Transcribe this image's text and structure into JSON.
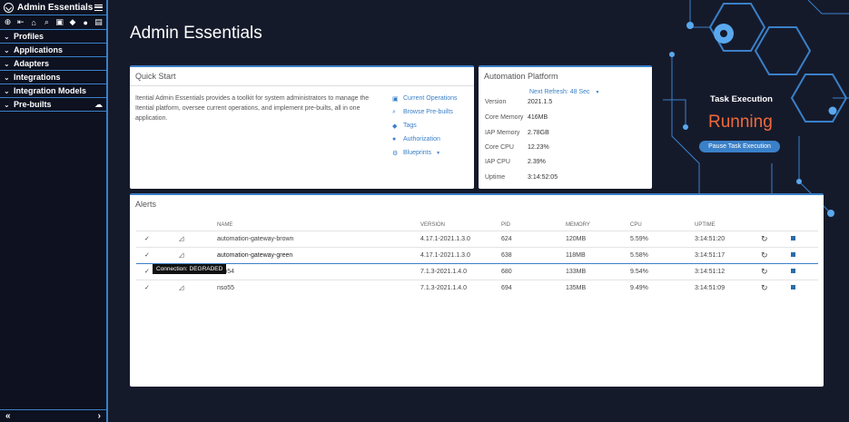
{
  "sidebar": {
    "title": "Admin Essentials",
    "tools": [
      "⊕",
      "⇤",
      "⌂",
      "⌕",
      "▣",
      "◆",
      "●",
      "▤"
    ],
    "items": [
      {
        "label": "Profiles"
      },
      {
        "label": "Applications"
      },
      {
        "label": "Adapters"
      },
      {
        "label": "Integrations"
      },
      {
        "label": "Integration Models"
      },
      {
        "label": "Pre-builts"
      }
    ],
    "footer_left": "«",
    "footer_right": "›"
  },
  "page": {
    "title": "Admin Essentials"
  },
  "quick_start": {
    "title": "Quick Start",
    "description": "Itential Admin Essentials provides a toolkit for system administrators to manage the Itential platform, oversee current operations, and implement pre-builts, all in one application.",
    "links": [
      {
        "label": "Current Operations",
        "icon": "briefcase-icon"
      },
      {
        "label": "Browse Pre-builts",
        "icon": "search-icon"
      },
      {
        "label": "Tags",
        "icon": "tag-icon"
      },
      {
        "label": "Authorization",
        "icon": "user-circle-icon"
      },
      {
        "label": "Blueprints",
        "icon": "gear-icon"
      }
    ]
  },
  "automation_platform": {
    "title": "Automation Platform",
    "next_refresh": "Next Refresh: 48 Sec",
    "rows": [
      {
        "key": "Version",
        "value": "2021.1.5"
      },
      {
        "key": "Core Memory",
        "value": "416MB"
      },
      {
        "key": "IAP Memory",
        "value": "2.78GB"
      },
      {
        "key": "Core CPU",
        "value": "12.23%"
      },
      {
        "key": "IAP CPU",
        "value": "2.39%"
      },
      {
        "key": "Uptime",
        "value": "3:14:52:05"
      }
    ]
  },
  "task_execution": {
    "title": "Task Execution",
    "status": "Running",
    "status_color": "#f06a3a",
    "button": "Pause Task Execution"
  },
  "alerts": {
    "title": "Alerts",
    "headers": [
      "NAME",
      "VERSION",
      "PID",
      "MEMORY",
      "CPU",
      "UPTIME"
    ],
    "rows": [
      {
        "name": "automation-gateway-brown",
        "version": "4.17.1-2021.1.3.0",
        "pid": "624",
        "memory": "120MB",
        "cpu": "5.59%",
        "uptime": "3:14:51:20"
      },
      {
        "name": "automation-gateway-green",
        "version": "4.17.1-2021.1.3.0",
        "pid": "638",
        "memory": "118MB",
        "cpu": "5.58%",
        "uptime": "3:14:51:17"
      },
      {
        "name": "nso54",
        "version": "7.1.3-2021.1.4.0",
        "pid": "680",
        "memory": "133MB",
        "cpu": "9.54%",
        "uptime": "3:14:51:12"
      },
      {
        "name": "nso55",
        "version": "7.1.3-2021.1.4.0",
        "pid": "694",
        "memory": "135MB",
        "cpu": "9.49%",
        "uptime": "3:14:51:09"
      }
    ],
    "tooltip": "Connection: DEGRADED"
  },
  "colors": {
    "accent": "#3a80c8",
    "background": "#151a2b",
    "warning": "#d23a3a"
  }
}
